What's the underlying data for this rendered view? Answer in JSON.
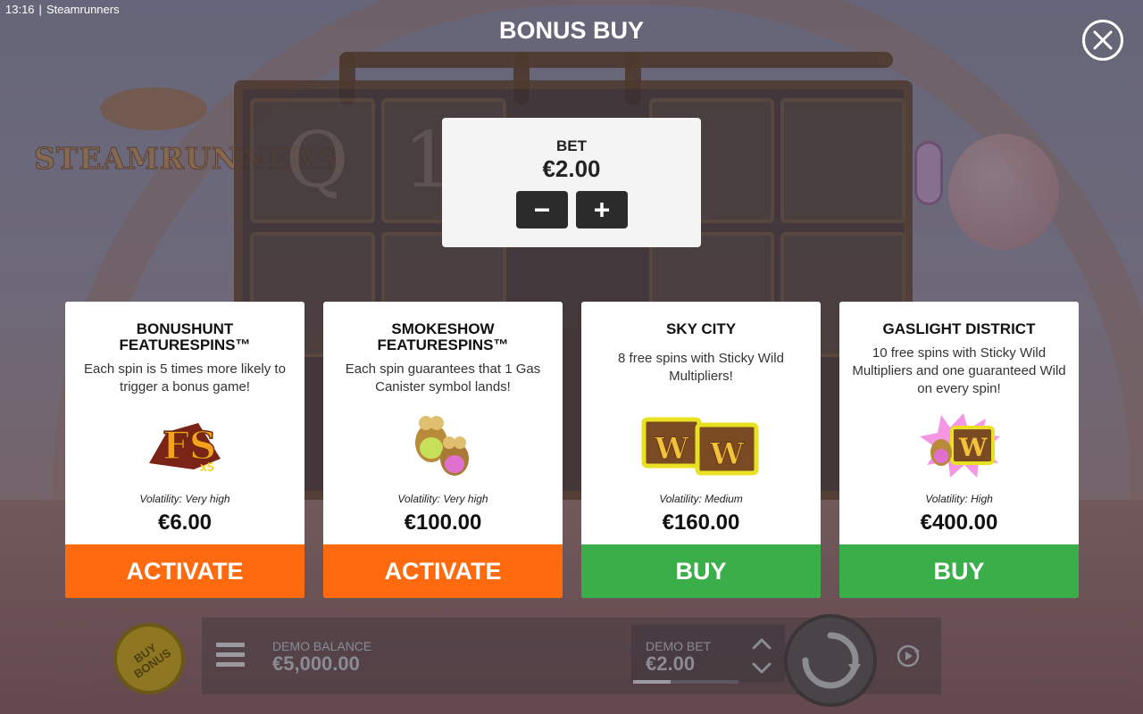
{
  "status_bar": {
    "time": "13:16",
    "app_name": "Steamrunners"
  },
  "header": {
    "title": "BONUS BUY",
    "close_icon": "close-icon"
  },
  "bet_panel": {
    "label": "BET",
    "value": "€2.00",
    "decrease_icon": "minus-icon",
    "increase_icon": "plus-icon"
  },
  "cards": [
    {
      "title": "BONUSHUNT FEATURESPINS™",
      "description": "Each spin is 5 times more likely to trigger a bonus game!",
      "art_icon": "fs-x5-icon",
      "volatility": "Volatility: Very high",
      "price": "€6.00",
      "action": "ACTIVATE",
      "action_color": "#ff6a0f"
    },
    {
      "title": "SMOKESHOW FEATURESPINS™",
      "description": "Each spin guarantees that 1 Gas Canister symbol lands!",
      "art_icon": "gas-canister-icon",
      "volatility": "Volatility: Very high",
      "price": "€100.00",
      "action": "ACTIVATE",
      "action_color": "#ff6a0f"
    },
    {
      "title": "SKY CITY",
      "description": "8 free spins with Sticky Wild Multipliers!",
      "art_icon": "wild-chests-icon",
      "volatility": "Volatility: Medium",
      "price": "€160.00",
      "action": "BUY",
      "action_color": "#3aae48"
    },
    {
      "title": "GASLIGHT DISTRICT",
      "description": "10 free spins with Sticky Wild Multipliers and one guaranteed Wild on every spin!",
      "art_icon": "gaslight-wild-icon",
      "volatility": "Volatility: High",
      "price": "€400.00",
      "action": "BUY",
      "action_color": "#3aae48"
    }
  ],
  "bottom_bar": {
    "buy_bonus_label": "BUY BONUS",
    "menu_icon": "hamburger-menu-icon",
    "balance_label": "DEMO BALANCE",
    "balance_value": "€5,000.00",
    "bet_label": "DEMO BET",
    "bet_value": "€2.00",
    "bet_level_fraction": 0.36,
    "bet_up_icon": "chevron-up-icon",
    "bet_down_icon": "chevron-down-icon",
    "spin_icon": "spin-icon",
    "autoplay_icon": "autoplay-icon"
  },
  "colors": {
    "activate": "#ff6a0f",
    "buy": "#3aae48",
    "panel_bg": "#ffffff",
    "bet_button": "#2b2b2b"
  }
}
